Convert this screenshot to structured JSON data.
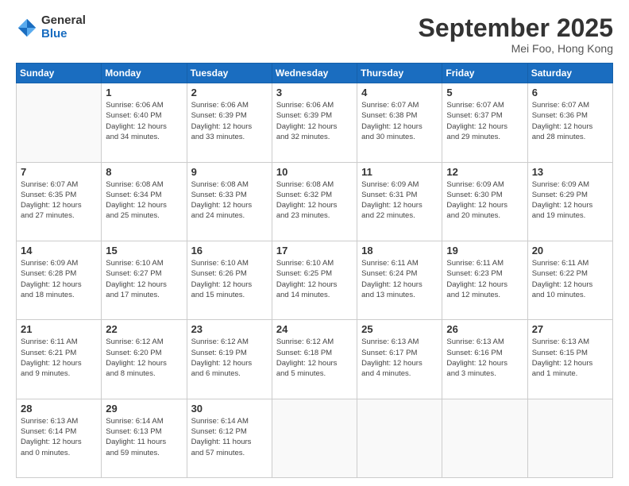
{
  "logo": {
    "general": "General",
    "blue": "Blue"
  },
  "header": {
    "month_year": "September 2025",
    "location": "Mei Foo, Hong Kong"
  },
  "days_of_week": [
    "Sunday",
    "Monday",
    "Tuesday",
    "Wednesday",
    "Thursday",
    "Friday",
    "Saturday"
  ],
  "weeks": [
    [
      {
        "day": "",
        "info": ""
      },
      {
        "day": "1",
        "info": "Sunrise: 6:06 AM\nSunset: 6:40 PM\nDaylight: 12 hours\nand 34 minutes."
      },
      {
        "day": "2",
        "info": "Sunrise: 6:06 AM\nSunset: 6:39 PM\nDaylight: 12 hours\nand 33 minutes."
      },
      {
        "day": "3",
        "info": "Sunrise: 6:06 AM\nSunset: 6:39 PM\nDaylight: 12 hours\nand 32 minutes."
      },
      {
        "day": "4",
        "info": "Sunrise: 6:07 AM\nSunset: 6:38 PM\nDaylight: 12 hours\nand 30 minutes."
      },
      {
        "day": "5",
        "info": "Sunrise: 6:07 AM\nSunset: 6:37 PM\nDaylight: 12 hours\nand 29 minutes."
      },
      {
        "day": "6",
        "info": "Sunrise: 6:07 AM\nSunset: 6:36 PM\nDaylight: 12 hours\nand 28 minutes."
      }
    ],
    [
      {
        "day": "7",
        "info": "Sunrise: 6:07 AM\nSunset: 6:35 PM\nDaylight: 12 hours\nand 27 minutes."
      },
      {
        "day": "8",
        "info": "Sunrise: 6:08 AM\nSunset: 6:34 PM\nDaylight: 12 hours\nand 25 minutes."
      },
      {
        "day": "9",
        "info": "Sunrise: 6:08 AM\nSunset: 6:33 PM\nDaylight: 12 hours\nand 24 minutes."
      },
      {
        "day": "10",
        "info": "Sunrise: 6:08 AM\nSunset: 6:32 PM\nDaylight: 12 hours\nand 23 minutes."
      },
      {
        "day": "11",
        "info": "Sunrise: 6:09 AM\nSunset: 6:31 PM\nDaylight: 12 hours\nand 22 minutes."
      },
      {
        "day": "12",
        "info": "Sunrise: 6:09 AM\nSunset: 6:30 PM\nDaylight: 12 hours\nand 20 minutes."
      },
      {
        "day": "13",
        "info": "Sunrise: 6:09 AM\nSunset: 6:29 PM\nDaylight: 12 hours\nand 19 minutes."
      }
    ],
    [
      {
        "day": "14",
        "info": "Sunrise: 6:09 AM\nSunset: 6:28 PM\nDaylight: 12 hours\nand 18 minutes."
      },
      {
        "day": "15",
        "info": "Sunrise: 6:10 AM\nSunset: 6:27 PM\nDaylight: 12 hours\nand 17 minutes."
      },
      {
        "day": "16",
        "info": "Sunrise: 6:10 AM\nSunset: 6:26 PM\nDaylight: 12 hours\nand 15 minutes."
      },
      {
        "day": "17",
        "info": "Sunrise: 6:10 AM\nSunset: 6:25 PM\nDaylight: 12 hours\nand 14 minutes."
      },
      {
        "day": "18",
        "info": "Sunrise: 6:11 AM\nSunset: 6:24 PM\nDaylight: 12 hours\nand 13 minutes."
      },
      {
        "day": "19",
        "info": "Sunrise: 6:11 AM\nSunset: 6:23 PM\nDaylight: 12 hours\nand 12 minutes."
      },
      {
        "day": "20",
        "info": "Sunrise: 6:11 AM\nSunset: 6:22 PM\nDaylight: 12 hours\nand 10 minutes."
      }
    ],
    [
      {
        "day": "21",
        "info": "Sunrise: 6:11 AM\nSunset: 6:21 PM\nDaylight: 12 hours\nand 9 minutes."
      },
      {
        "day": "22",
        "info": "Sunrise: 6:12 AM\nSunset: 6:20 PM\nDaylight: 12 hours\nand 8 minutes."
      },
      {
        "day": "23",
        "info": "Sunrise: 6:12 AM\nSunset: 6:19 PM\nDaylight: 12 hours\nand 6 minutes."
      },
      {
        "day": "24",
        "info": "Sunrise: 6:12 AM\nSunset: 6:18 PM\nDaylight: 12 hours\nand 5 minutes."
      },
      {
        "day": "25",
        "info": "Sunrise: 6:13 AM\nSunset: 6:17 PM\nDaylight: 12 hours\nand 4 minutes."
      },
      {
        "day": "26",
        "info": "Sunrise: 6:13 AM\nSunset: 6:16 PM\nDaylight: 12 hours\nand 3 minutes."
      },
      {
        "day": "27",
        "info": "Sunrise: 6:13 AM\nSunset: 6:15 PM\nDaylight: 12 hours\nand 1 minute."
      }
    ],
    [
      {
        "day": "28",
        "info": "Sunrise: 6:13 AM\nSunset: 6:14 PM\nDaylight: 12 hours\nand 0 minutes."
      },
      {
        "day": "29",
        "info": "Sunrise: 6:14 AM\nSunset: 6:13 PM\nDaylight: 11 hours\nand 59 minutes."
      },
      {
        "day": "30",
        "info": "Sunrise: 6:14 AM\nSunset: 6:12 PM\nDaylight: 11 hours\nand 57 minutes."
      },
      {
        "day": "",
        "info": ""
      },
      {
        "day": "",
        "info": ""
      },
      {
        "day": "",
        "info": ""
      },
      {
        "day": "",
        "info": ""
      }
    ]
  ]
}
